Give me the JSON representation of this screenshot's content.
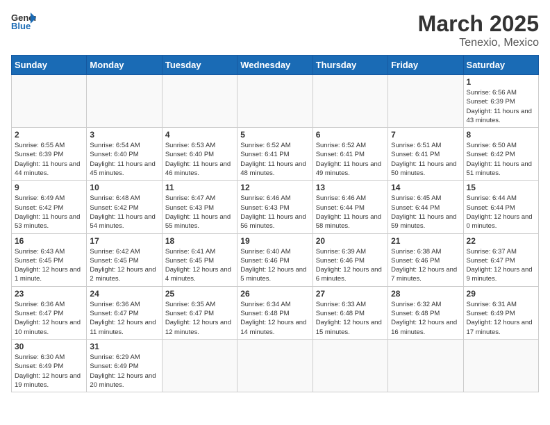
{
  "logo": {
    "general": "General",
    "blue": "Blue"
  },
  "title": "March 2025",
  "subtitle": "Tenexio, Mexico",
  "weekdays": [
    "Sunday",
    "Monday",
    "Tuesday",
    "Wednesday",
    "Thursday",
    "Friday",
    "Saturday"
  ],
  "weeks": [
    [
      {
        "day": "",
        "info": ""
      },
      {
        "day": "",
        "info": ""
      },
      {
        "day": "",
        "info": ""
      },
      {
        "day": "",
        "info": ""
      },
      {
        "day": "",
        "info": ""
      },
      {
        "day": "",
        "info": ""
      },
      {
        "day": "1",
        "info": "Sunrise: 6:56 AM\nSunset: 6:39 PM\nDaylight: 11 hours and 43 minutes."
      }
    ],
    [
      {
        "day": "2",
        "info": "Sunrise: 6:55 AM\nSunset: 6:39 PM\nDaylight: 11 hours and 44 minutes."
      },
      {
        "day": "3",
        "info": "Sunrise: 6:54 AM\nSunset: 6:40 PM\nDaylight: 11 hours and 45 minutes."
      },
      {
        "day": "4",
        "info": "Sunrise: 6:53 AM\nSunset: 6:40 PM\nDaylight: 11 hours and 46 minutes."
      },
      {
        "day": "5",
        "info": "Sunrise: 6:52 AM\nSunset: 6:41 PM\nDaylight: 11 hours and 48 minutes."
      },
      {
        "day": "6",
        "info": "Sunrise: 6:52 AM\nSunset: 6:41 PM\nDaylight: 11 hours and 49 minutes."
      },
      {
        "day": "7",
        "info": "Sunrise: 6:51 AM\nSunset: 6:41 PM\nDaylight: 11 hours and 50 minutes."
      },
      {
        "day": "8",
        "info": "Sunrise: 6:50 AM\nSunset: 6:42 PM\nDaylight: 11 hours and 51 minutes."
      }
    ],
    [
      {
        "day": "9",
        "info": "Sunrise: 6:49 AM\nSunset: 6:42 PM\nDaylight: 11 hours and 53 minutes."
      },
      {
        "day": "10",
        "info": "Sunrise: 6:48 AM\nSunset: 6:42 PM\nDaylight: 11 hours and 54 minutes."
      },
      {
        "day": "11",
        "info": "Sunrise: 6:47 AM\nSunset: 6:43 PM\nDaylight: 11 hours and 55 minutes."
      },
      {
        "day": "12",
        "info": "Sunrise: 6:46 AM\nSunset: 6:43 PM\nDaylight: 11 hours and 56 minutes."
      },
      {
        "day": "13",
        "info": "Sunrise: 6:46 AM\nSunset: 6:44 PM\nDaylight: 11 hours and 58 minutes."
      },
      {
        "day": "14",
        "info": "Sunrise: 6:45 AM\nSunset: 6:44 PM\nDaylight: 11 hours and 59 minutes."
      },
      {
        "day": "15",
        "info": "Sunrise: 6:44 AM\nSunset: 6:44 PM\nDaylight: 12 hours and 0 minutes."
      }
    ],
    [
      {
        "day": "16",
        "info": "Sunrise: 6:43 AM\nSunset: 6:45 PM\nDaylight: 12 hours and 1 minute."
      },
      {
        "day": "17",
        "info": "Sunrise: 6:42 AM\nSunset: 6:45 PM\nDaylight: 12 hours and 2 minutes."
      },
      {
        "day": "18",
        "info": "Sunrise: 6:41 AM\nSunset: 6:45 PM\nDaylight: 12 hours and 4 minutes."
      },
      {
        "day": "19",
        "info": "Sunrise: 6:40 AM\nSunset: 6:46 PM\nDaylight: 12 hours and 5 minutes."
      },
      {
        "day": "20",
        "info": "Sunrise: 6:39 AM\nSunset: 6:46 PM\nDaylight: 12 hours and 6 minutes."
      },
      {
        "day": "21",
        "info": "Sunrise: 6:38 AM\nSunset: 6:46 PM\nDaylight: 12 hours and 7 minutes."
      },
      {
        "day": "22",
        "info": "Sunrise: 6:37 AM\nSunset: 6:47 PM\nDaylight: 12 hours and 9 minutes."
      }
    ],
    [
      {
        "day": "23",
        "info": "Sunrise: 6:36 AM\nSunset: 6:47 PM\nDaylight: 12 hours and 10 minutes."
      },
      {
        "day": "24",
        "info": "Sunrise: 6:36 AM\nSunset: 6:47 PM\nDaylight: 12 hours and 11 minutes."
      },
      {
        "day": "25",
        "info": "Sunrise: 6:35 AM\nSunset: 6:47 PM\nDaylight: 12 hours and 12 minutes."
      },
      {
        "day": "26",
        "info": "Sunrise: 6:34 AM\nSunset: 6:48 PM\nDaylight: 12 hours and 14 minutes."
      },
      {
        "day": "27",
        "info": "Sunrise: 6:33 AM\nSunset: 6:48 PM\nDaylight: 12 hours and 15 minutes."
      },
      {
        "day": "28",
        "info": "Sunrise: 6:32 AM\nSunset: 6:48 PM\nDaylight: 12 hours and 16 minutes."
      },
      {
        "day": "29",
        "info": "Sunrise: 6:31 AM\nSunset: 6:49 PM\nDaylight: 12 hours and 17 minutes."
      }
    ],
    [
      {
        "day": "30",
        "info": "Sunrise: 6:30 AM\nSunset: 6:49 PM\nDaylight: 12 hours and 19 minutes."
      },
      {
        "day": "31",
        "info": "Sunrise: 6:29 AM\nSunset: 6:49 PM\nDaylight: 12 hours and 20 minutes."
      },
      {
        "day": "",
        "info": ""
      },
      {
        "day": "",
        "info": ""
      },
      {
        "day": "",
        "info": ""
      },
      {
        "day": "",
        "info": ""
      },
      {
        "day": "",
        "info": ""
      }
    ]
  ]
}
